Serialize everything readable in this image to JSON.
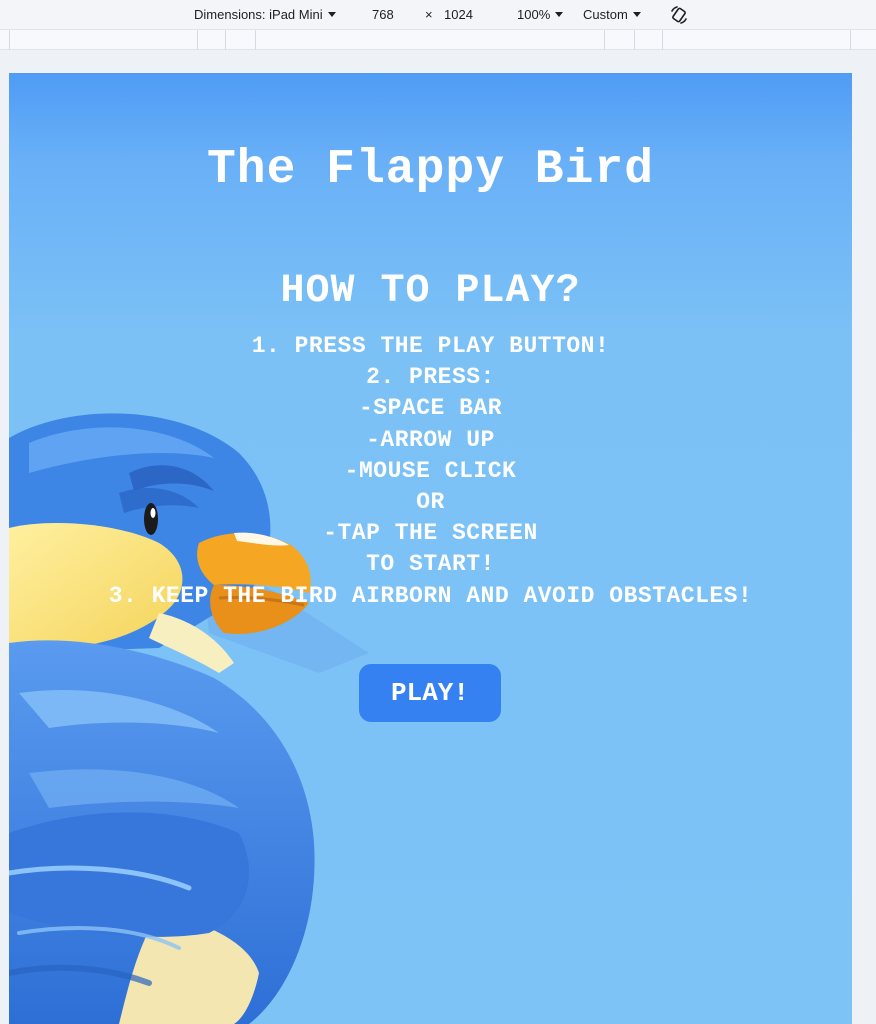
{
  "devtools": {
    "dimensions_label": "Dimensions: iPad Mini",
    "width": "768",
    "times": "×",
    "height": "1024",
    "zoom": "100%",
    "throttle": "Custom",
    "rotate_icon": "rotate-device-icon"
  },
  "game": {
    "title": "The Flappy Bird",
    "how_to_heading": "HOW TO PLAY?",
    "instructions": [
      "1. PRESS THE PLAY BUTTON!",
      "2. PRESS:",
      "-SPACE BAR",
      "-ARROW UP",
      "-MOUSE CLICK",
      "OR",
      "-TAP THE SCREEN",
      "TO START!",
      "3. KEEP THE BIRD AIRBORN AND AVOID OBSTACLES!"
    ],
    "play_button": "PLAY!",
    "bird_image": "bird-illustration"
  },
  "colors": {
    "sky_top": "#4f9cf5",
    "sky_bottom": "#7ec3f6",
    "play_button_bg": "#3681f1",
    "bird_blue": "#3b7fe0",
    "beak": "#f5a623"
  }
}
